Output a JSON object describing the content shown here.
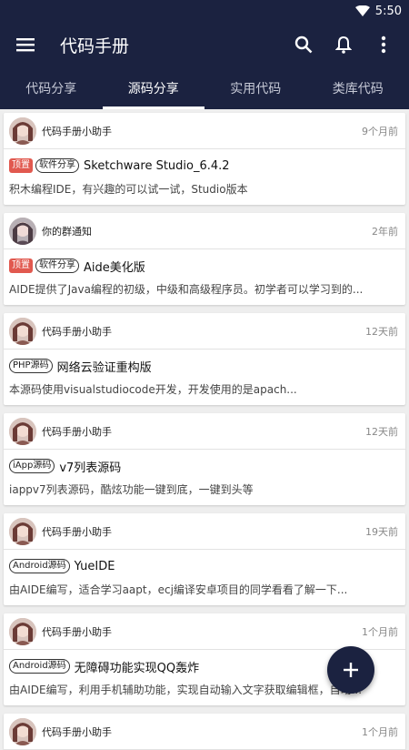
{
  "status_bar": {
    "time": "5:50"
  },
  "app_bar": {
    "title": "代码手册",
    "icons": [
      "menu-icon",
      "search-icon",
      "bell-icon",
      "more-vert-icon"
    ]
  },
  "tabs": [
    {
      "label": "代码分享",
      "active": false
    },
    {
      "label": "源码分享",
      "active": true
    },
    {
      "label": "实用代码",
      "active": false
    },
    {
      "label": "类库代码",
      "active": false
    }
  ],
  "posts": [
    {
      "author": "代码手册小助手",
      "time": "9个月前",
      "top": "顶置",
      "category": "软件分享",
      "title": "Sketchware Studio_6.4.2",
      "desc": "积木编程IDE，有兴趣的可以试一试，Studio版本"
    },
    {
      "author": "你的群通知",
      "time": "2年前",
      "top": "顶置",
      "category": "软件分享",
      "title": "Aide美化版",
      "desc": "AIDE提供了Java编程的初级，中级和高级程序员。初学者可以学习到的..."
    },
    {
      "author": "代码手册小助手",
      "time": "12天前",
      "top": "",
      "category": "PHP源码",
      "title": "网络云验证重构版",
      "desc": "本源码使用visualstudiocode开发，开发使用的是apach..."
    },
    {
      "author": "代码手册小助手",
      "time": "12天前",
      "top": "",
      "category": "iApp源码",
      "title": "v7列表源码",
      "desc": "iappv7列表源码，酷炫功能一键到底，一键到头等"
    },
    {
      "author": "代码手册小助手",
      "time": "19天前",
      "top": "",
      "category": "Android源码",
      "title": "YueIDE",
      "desc": "由AIDE编写，适合学习aapt，ecj编译安卓项目的同学看看了解一下..."
    },
    {
      "author": "代码手册小助手",
      "time": "1个月前",
      "top": "",
      "category": "Android源码",
      "title": "无障碍功能实现QQ轰炸",
      "desc": "由AIDE编写，利用手机辅助功能，实现自动输入文字获取编辑框，自动..."
    },
    {
      "author": "代码手册小助手",
      "time": "1个月前",
      "top": "",
      "category": "",
      "title": "",
      "desc": ""
    }
  ],
  "fab": {
    "icon": "plus-icon"
  },
  "colors": {
    "primary": "#1b2240",
    "top_badge": "#e1594f"
  }
}
